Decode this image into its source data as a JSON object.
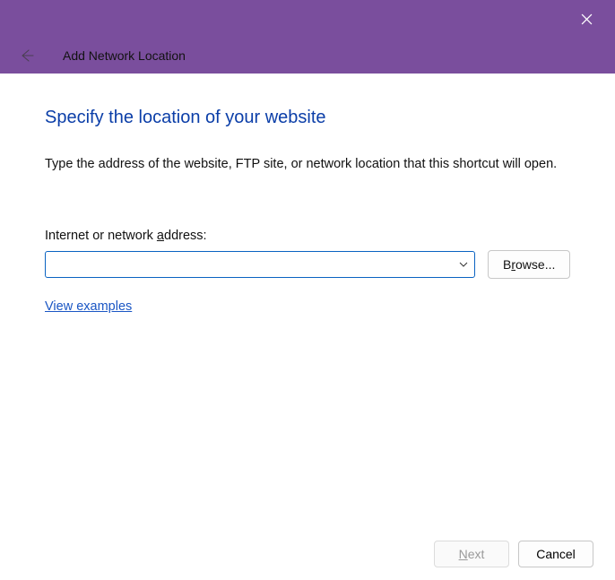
{
  "window": {
    "close_tooltip": "Close"
  },
  "header": {
    "title": "Add Network Location"
  },
  "page": {
    "title": "Specify the location of your website",
    "instruction": "Type the address of the website, FTP site, or network location that this shortcut will open.",
    "address_label_pre": "Internet or network ",
    "address_label_accel": "a",
    "address_label_post": "ddress:",
    "address_value": "",
    "browse_pre": "B",
    "browse_accel": "r",
    "browse_post": "owse...",
    "examples_link": "View examples"
  },
  "footer": {
    "next_accel": "N",
    "next_post": "ext",
    "cancel": "Cancel"
  }
}
